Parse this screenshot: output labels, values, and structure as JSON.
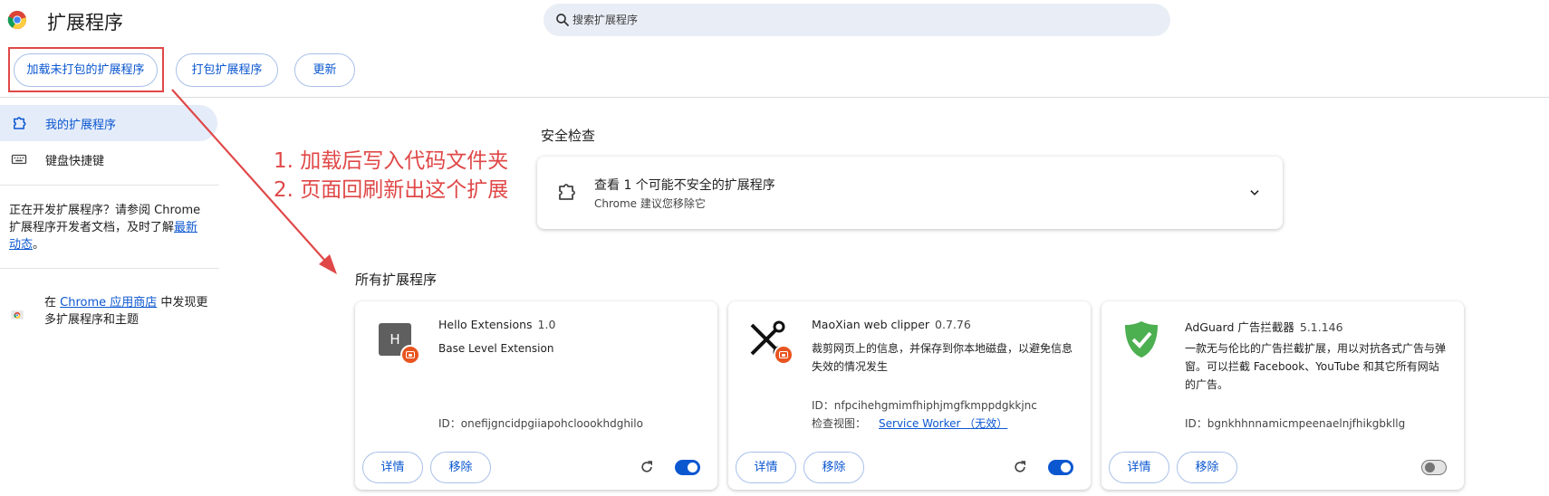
{
  "header": {
    "title": "扩展程序",
    "search_placeholder": "搜索扩展程序"
  },
  "toolbar": {
    "load_unpacked": "加载未打包的扩展程序",
    "pack": "打包扩展程序",
    "update": "更新"
  },
  "sidebar": {
    "items": [
      {
        "label": "我的扩展程序",
        "active": true
      },
      {
        "label": "键盘快捷键",
        "active": false
      }
    ],
    "dev_note_prefix": "正在开发扩展程序？请参阅 Chrome 扩展程序开发者文档，及时了解",
    "dev_note_link": "最新动态",
    "dev_note_suffix": "。",
    "store_prefix": "在 ",
    "store_link": "Chrome 应用商店",
    "store_suffix": " 中发现更多扩展程序和主题"
  },
  "annotation": {
    "line1": "1. 加载后写入代码文件夹",
    "line2": "2. 页面回刷新出这个扩展",
    "color": "#e04848"
  },
  "safety": {
    "section_title": "安全检查",
    "title": "查看 1 个可能不安全的扩展程序",
    "subtitle": "Chrome 建议您移除它"
  },
  "extensions_section": {
    "title": "所有扩展程序"
  },
  "extensions": [
    {
      "name": "Hello Extensions",
      "version": "1.0",
      "description": "Base Level Extension",
      "id_label": "ID：",
      "id": "onefijgncidpgiiapohcloookhdghilo",
      "icon": "h-letter-icon",
      "icon_letter": "H",
      "enabled": true,
      "details": "详情",
      "remove": "移除"
    },
    {
      "name": "MaoXian web clipper",
      "version": "0.7.76",
      "description": "裁剪网页上的信息，并保存到你本地磁盘，以避免信息失效的情况发生",
      "id_label": "ID：",
      "id": "nfpcihehgmimfhiphjmgfkmppdgkkjnc",
      "inspect_label": "检查视图：",
      "inspect_link": "Service Worker （无效）",
      "icon": "scissors-icon",
      "enabled": true,
      "details": "详情",
      "remove": "移除"
    },
    {
      "name": "AdGuard 广告拦截器",
      "version": "5.1.146",
      "description": "一款无与伦比的广告拦截扩展，用以对抗各式广告与弹窗。可以拦截 Facebook、YouTube 和其它所有网站的广告。",
      "id_label": "ID：",
      "id": "bgnkhhnnamicmpeenaelnjfhikgbkllg",
      "icon": "shield-check-icon",
      "enabled": false,
      "details": "详情",
      "remove": "移除"
    }
  ],
  "colors": {
    "accent": "#0b57d0",
    "annotation_red": "#e04848",
    "badge_orange": "#e8541f",
    "adguard_green": "#4caf50"
  }
}
